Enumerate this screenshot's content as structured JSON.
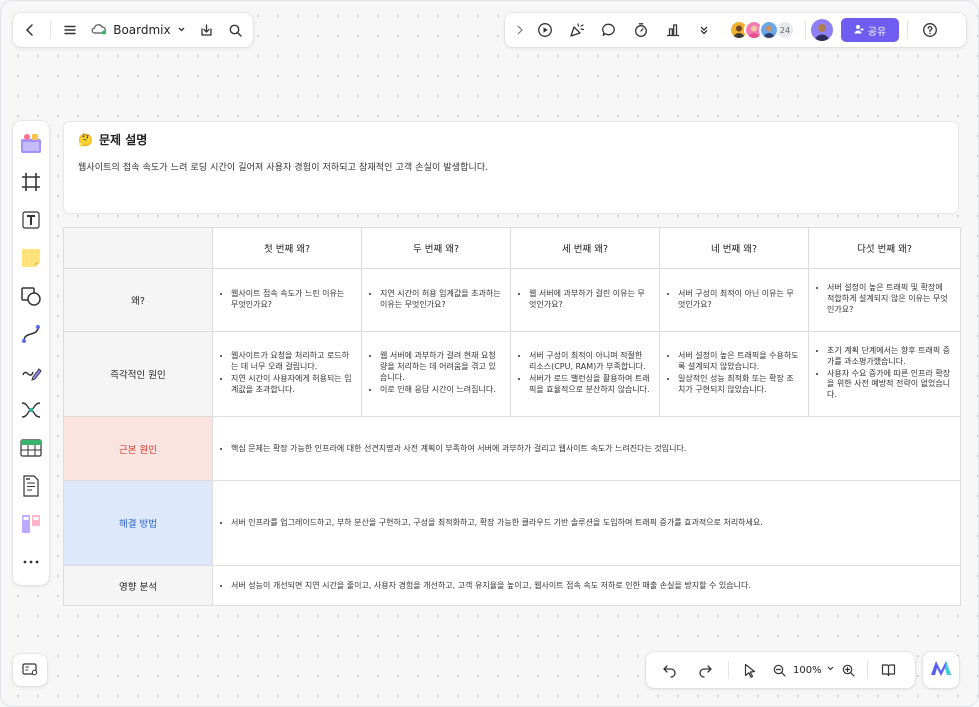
{
  "app": {
    "name": "Boardmix",
    "share_label": "공유",
    "collaborator_count": "24",
    "zoom_level": "100%"
  },
  "header_card": {
    "emoji": "🤔",
    "title": "문제 설명",
    "description": "웹사이트의 접속 속도가 느려 로딩 시간이 길어져 사용자 경험이 저하되고 잠재적인 고객 손실이 발생합니다."
  },
  "table": {
    "columns": [
      "첫 번째 왜?",
      "두 번째 왜?",
      "세 번째 왜?",
      "네 번째 왜?",
      "다섯 번째 왜?"
    ],
    "why_row": {
      "label": "왜?",
      "cells": [
        [
          "웹사이트 접속 속도가 느린 이유는 무엇인가요?"
        ],
        [
          "지연 시간이 허용 임계값을 초과하는 이유는 무엇인가요?"
        ],
        [
          "웹 서버에 과부하가 걸린 이유는 무엇인가요?"
        ],
        [
          "서버 구성이 최적이 아닌 이유는 무엇인가요?"
        ],
        [
          "서버 설정이 높은 트래픽 및 확장에 적합하게 설계되지 않은 이유는 무엇인가요?"
        ]
      ]
    },
    "immediate_row": {
      "label": "즉각적인 원인",
      "cells": [
        [
          "웹사이트가 요청을 처리하고 로드하는 데 너무 오래 걸립니다.",
          "지연 시간이 사용자에게 허용되는 임계값을 초과합니다."
        ],
        [
          "웹 서버에 과부하가 걸려 현재 요청량을 처리하는 데 어려움을 겪고 있습니다.",
          "이로 인해 응답 시간이 느려집니다."
        ],
        [
          "서버 구성이 최적이 아니며 적절한 리소스(CPU, RAM)가 부족합니다.",
          "서버가 로드 밸런싱을 활용하여 트래픽을 효율적으로 분산하지 않습니다."
        ],
        [
          "서버 설정이 높은 트래픽을 수용하도록 설계되지 않았습니다.",
          "일상적인 성능 최적화 또는 확장 조치가 구현되지 않았습니다."
        ],
        [
          "초기 계획 단계에서는 향후 트래픽 증가를 과소평가했습니다.",
          "사용자 수요 증가에 따른 인프라 확장을 위한 사전 예방적 전략이 없었습니다."
        ]
      ]
    },
    "root_cause": {
      "label": "근본 원인",
      "text": "핵심 문제는 확장 가능한 인프라에 대한 선견지명과 사전 계획이 부족하여 서버에 과부하가 걸리고 웹사이트 속도가 느려진다는 것입니다."
    },
    "solution": {
      "label": "해결 방법",
      "text": "서버 인프라를 업그레이드하고, 부하 분산을 구현하고, 구성을 최적화하고, 확장 가능한 클라우드 기반 솔루션을 도입하여 트래픽 증가를 효과적으로 처리하세요."
    },
    "impact": {
      "label": "영향 분석",
      "text": "서버 성능이 개선되면 지연 시간을 줄이고, 사용자 경험을 개선하고, 고객 유지율을 높이고, 웹사이트 접속 속도 저하로 인한 매출 손실을 방지할 수 있습니다."
    }
  },
  "colors": {
    "accent": "#6f5cf1",
    "root_cause_bg": "#fbe3df",
    "root_cause_text": "#d23a2a",
    "solution_bg": "#dde9fb",
    "solution_text": "#2e62c9"
  },
  "icons": {
    "top_left": [
      "back-icon",
      "menu-icon",
      "cloud-sync-icon",
      "chevron-down-icon",
      "download-icon",
      "search-icon"
    ],
    "top_right": [
      "expand-icon",
      "play-icon",
      "celebrate-icon",
      "comment-icon",
      "timer-icon",
      "vote-icon",
      "more-chevron-icon",
      "help-icon"
    ],
    "left_tools": [
      "template-icon",
      "frame-icon",
      "text-icon",
      "sticky-note-icon",
      "shape-icon",
      "connector-icon",
      "pen-icon",
      "mindmap-icon",
      "table-icon",
      "document-icon",
      "kanban-icon",
      "more-icon"
    ],
    "bottom": [
      "minimap-icon",
      "undo-icon",
      "redo-icon",
      "select-icon",
      "zoom-out-icon",
      "zoom-in-icon",
      "book-icon",
      "boardmix-logo-icon"
    ]
  }
}
